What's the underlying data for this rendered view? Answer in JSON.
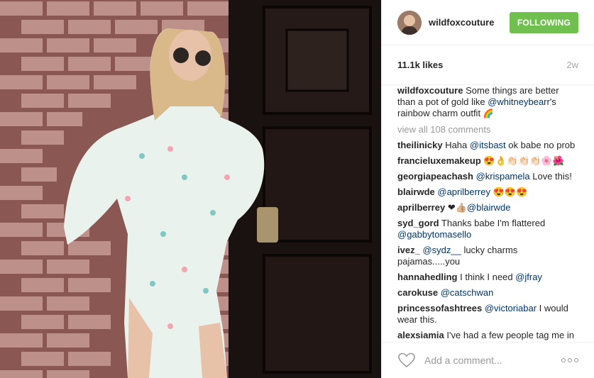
{
  "post": {
    "username": "wildfoxcouture",
    "follow_label": "FOLLOWING",
    "likes": "11.1k likes",
    "age": "2w",
    "caption_user": "wildfoxcouture",
    "caption_text_1": " Some things are better than a pot of gold like ",
    "caption_mention": "@whitneybearr",
    "caption_text_2": "'s rainbow charm outfit ",
    "caption_emoji": "🌈",
    "view_all": "view all 108 comments"
  },
  "comments": [
    {
      "user": "theilinicky",
      "pre": " Haha ",
      "mention": "@itsbast",
      "post": " ok babe no prob"
    },
    {
      "user": "francieluxemakeup",
      "pre": " 😍👌👏🏻👏🏻👏🏻🌸🌺",
      "mention": "",
      "post": ""
    },
    {
      "user": "georgiapeachash",
      "pre": " ",
      "mention": "@krispamela",
      "post": " Love this!"
    },
    {
      "user": "blairwde",
      "pre": " ",
      "mention": "@aprilberrey",
      "post": " 😍😍😍"
    },
    {
      "user": "aprilberrey",
      "pre": " ❤👍🏼",
      "mention": "@blairwde",
      "post": ""
    },
    {
      "user": "syd_gord",
      "pre": " Thanks babe I'm flattered ",
      "mention": "@gabbytomasello",
      "post": ""
    },
    {
      "user": "ivez_",
      "pre": " ",
      "mention": "@sydz__",
      "post": " lucky charms pajamas.....you"
    },
    {
      "user": "hannahedling",
      "pre": " I think I need ",
      "mention": "@jfray",
      "post": ""
    },
    {
      "user": "carokuse",
      "pre": " ",
      "mention": "@catschwan",
      "post": ""
    },
    {
      "user": "princessofashtrees",
      "pre": " ",
      "mention": "@victoriabar",
      "post": " I would wear this."
    },
    {
      "user": "alexsiamia",
      "pre": " I've had a few people tag me in",
      "mention": "",
      "post": ""
    }
  ],
  "footer": {
    "add_comment_placeholder": "Add a comment..."
  },
  "colors": {
    "follow_green": "#70c050",
    "mention_blue": "#003569"
  },
  "icons": {
    "like": "heart-outline-icon",
    "more": "more-options-icon"
  }
}
